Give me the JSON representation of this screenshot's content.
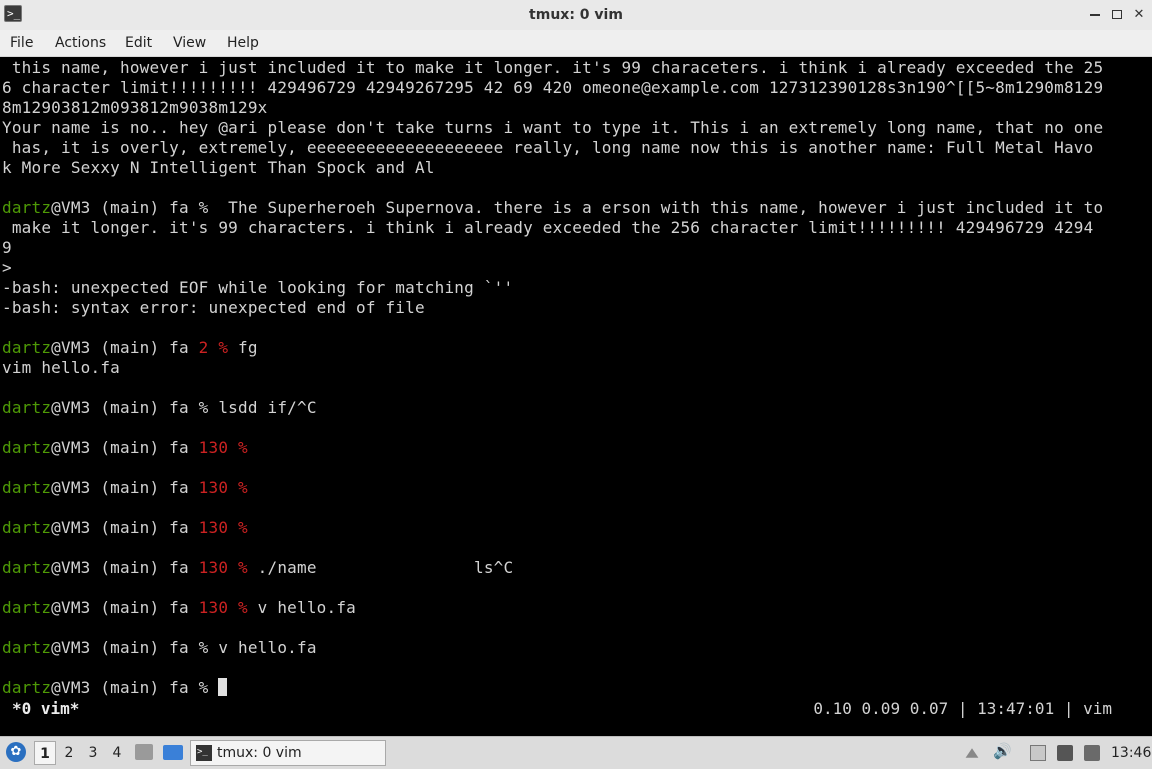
{
  "window": {
    "title": "tmux: 0 vim",
    "app_icon_glyph": ">_",
    "buttons": {
      "close_glyph": "✕"
    }
  },
  "menubar": [
    "File",
    "Actions",
    "Edit",
    "View",
    "Help"
  ],
  "terminal": {
    "lines": [
      [
        {
          "t": " this name, however i just included it to make it longer. it's 99 characeters. i think i already exceeded the 25"
        }
      ],
      [
        {
          "t": "6 character limit!!!!!!!!! 429496729 42949267295 42 69 420 omeone@example.com 127312390128s3n190^[[5~8m1290m8129"
        }
      ],
      [
        {
          "t": "8m12903812m093812m9038m129x"
        }
      ],
      [
        {
          "t": "Your name is no.. hey @ari please don't take turns i want to type it. This i an extremely long name, that no one"
        }
      ],
      [
        {
          "t": " has, it is overly, extremely, eeeeeeeeeeeeeeeeeeee really, long name now this is another name: Full Metal Havo"
        }
      ],
      [
        {
          "t": "k More Sexxy N Intelligent Than Spock and Al"
        }
      ],
      [],
      [
        {
          "t": "dartz",
          "c": "user"
        },
        {
          "t": "@VM3 (main) fa %  The Superheroeh Supernova. there is a erson with this name, however i just included it to"
        }
      ],
      [
        {
          "t": " make it longer. it's 99 characters. i think i already exceeded the 256 character limit!!!!!!!!! 429496729 4294"
        }
      ],
      [
        {
          "t": "9"
        }
      ],
      [
        {
          "t": ">"
        }
      ],
      [
        {
          "t": "-bash: unexpected EOF while looking for matching `''"
        }
      ],
      [
        {
          "t": "-bash: syntax error: unexpected end of file"
        }
      ],
      [],
      [
        {
          "t": "dartz",
          "c": "user"
        },
        {
          "t": "@VM3 (main) fa "
        },
        {
          "t": "2 %",
          "c": "err"
        },
        {
          "t": " fg"
        }
      ],
      [
        {
          "t": "vim hello.fa"
        }
      ],
      [],
      [
        {
          "t": "dartz",
          "c": "user"
        },
        {
          "t": "@VM3 (main) fa % lsdd if/^C"
        }
      ],
      [],
      [
        {
          "t": "dartz",
          "c": "user"
        },
        {
          "t": "@VM3 (main) fa "
        },
        {
          "t": "130 %",
          "c": "err"
        }
      ],
      [],
      [
        {
          "t": "dartz",
          "c": "user"
        },
        {
          "t": "@VM3 (main) fa "
        },
        {
          "t": "130 %",
          "c": "err"
        }
      ],
      [],
      [
        {
          "t": "dartz",
          "c": "user"
        },
        {
          "t": "@VM3 (main) fa "
        },
        {
          "t": "130 %",
          "c": "err"
        }
      ],
      [],
      [
        {
          "t": "dartz",
          "c": "user"
        },
        {
          "t": "@VM3 (main) fa "
        },
        {
          "t": "130 %",
          "c": "err"
        },
        {
          "t": " ./name                ls^C"
        }
      ],
      [],
      [
        {
          "t": "dartz",
          "c": "user"
        },
        {
          "t": "@VM3 (main) fa "
        },
        {
          "t": "130 %",
          "c": "err"
        },
        {
          "t": " v hello.fa"
        }
      ],
      [],
      [
        {
          "t": "dartz",
          "c": "user"
        },
        {
          "t": "@VM3 (main) fa % v hello.fa"
        }
      ],
      [],
      [
        {
          "t": "dartz",
          "c": "user"
        },
        {
          "t": "@VM3 (main) fa % "
        },
        {
          "cursor": true
        }
      ]
    ],
    "colors": {
      "user": "#4e9a06",
      "err": "#cc2222",
      "text": "#d3d3d3",
      "background": "#000000"
    }
  },
  "tmux_status": {
    "left": "*0 vim*",
    "right": "0.10 0.09 0.07 | 13:47:01 | vim"
  },
  "taskbar": {
    "workspaces": [
      "1",
      "2",
      "3",
      "4"
    ],
    "active_workspace": "1",
    "task_label": "tmux: 0 vim",
    "volume_glyph": "🔊",
    "clock": "13:46"
  }
}
